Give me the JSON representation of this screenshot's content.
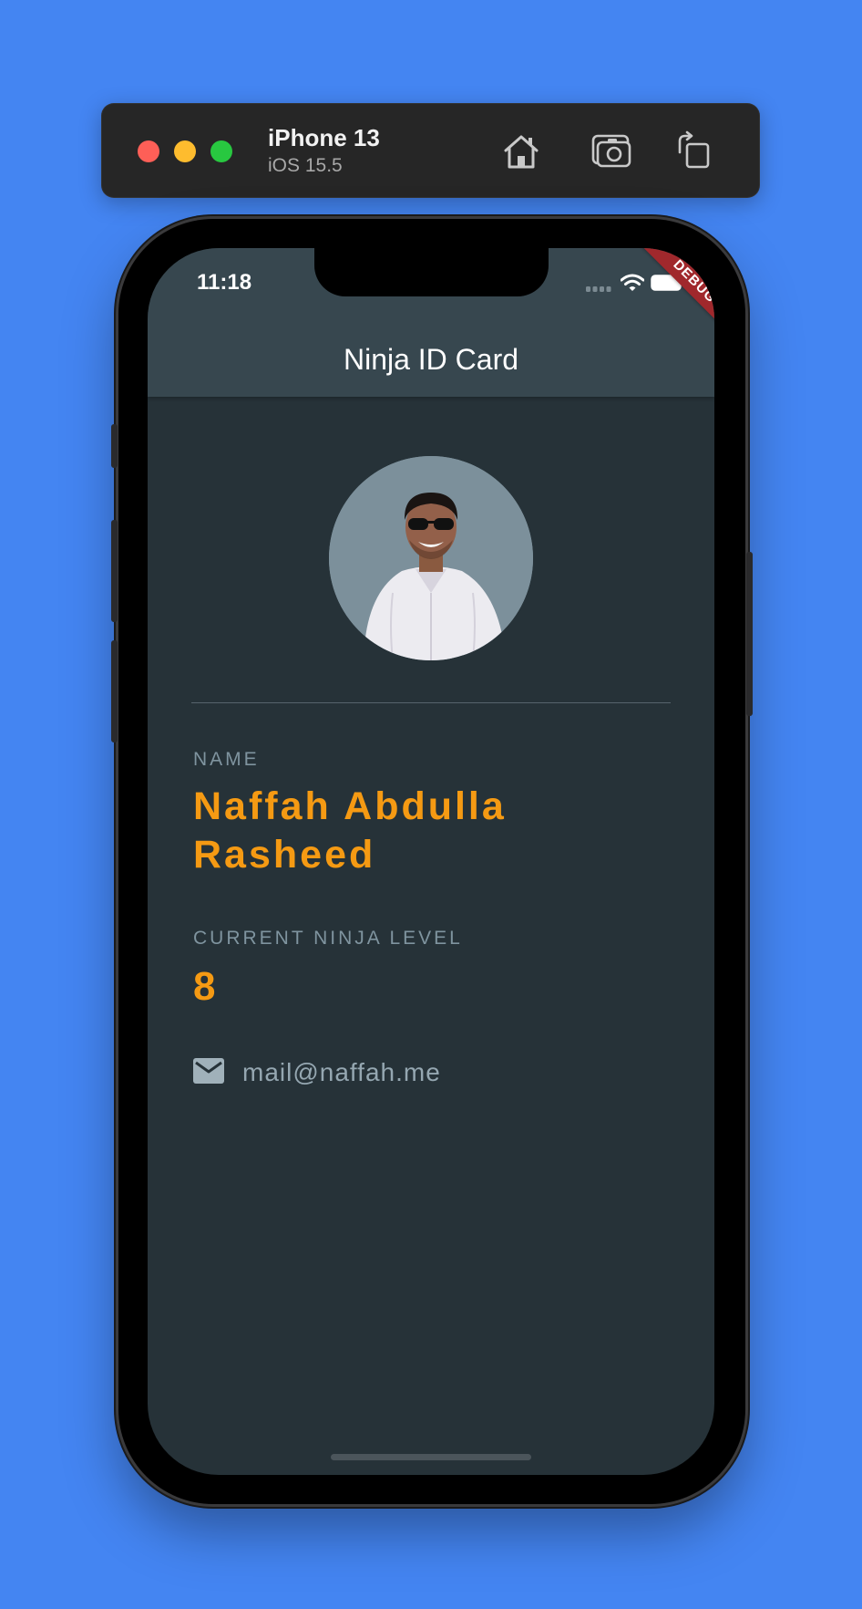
{
  "toolbar": {
    "device_name": "iPhone 13",
    "device_os": "iOS 15.5",
    "buttons": [
      "home-icon",
      "screenshot-icon",
      "rotate-icon"
    ]
  },
  "status_bar": {
    "time": "11:18"
  },
  "debug_banner": "DEBUG",
  "app_bar": {
    "title": "Ninja ID Card"
  },
  "profile": {
    "name_label": "NAME",
    "name": "Naffah Abdulla Rasheed",
    "level_label": "CURRENT NINJA LEVEL",
    "level": "8",
    "email": "mail@naffah.me"
  },
  "colors": {
    "background": "#4485f2",
    "app_bar": "#37474f",
    "body": "#263238",
    "accent": "#f59a13",
    "label": "#7f949f",
    "debug": "#a0282c"
  }
}
